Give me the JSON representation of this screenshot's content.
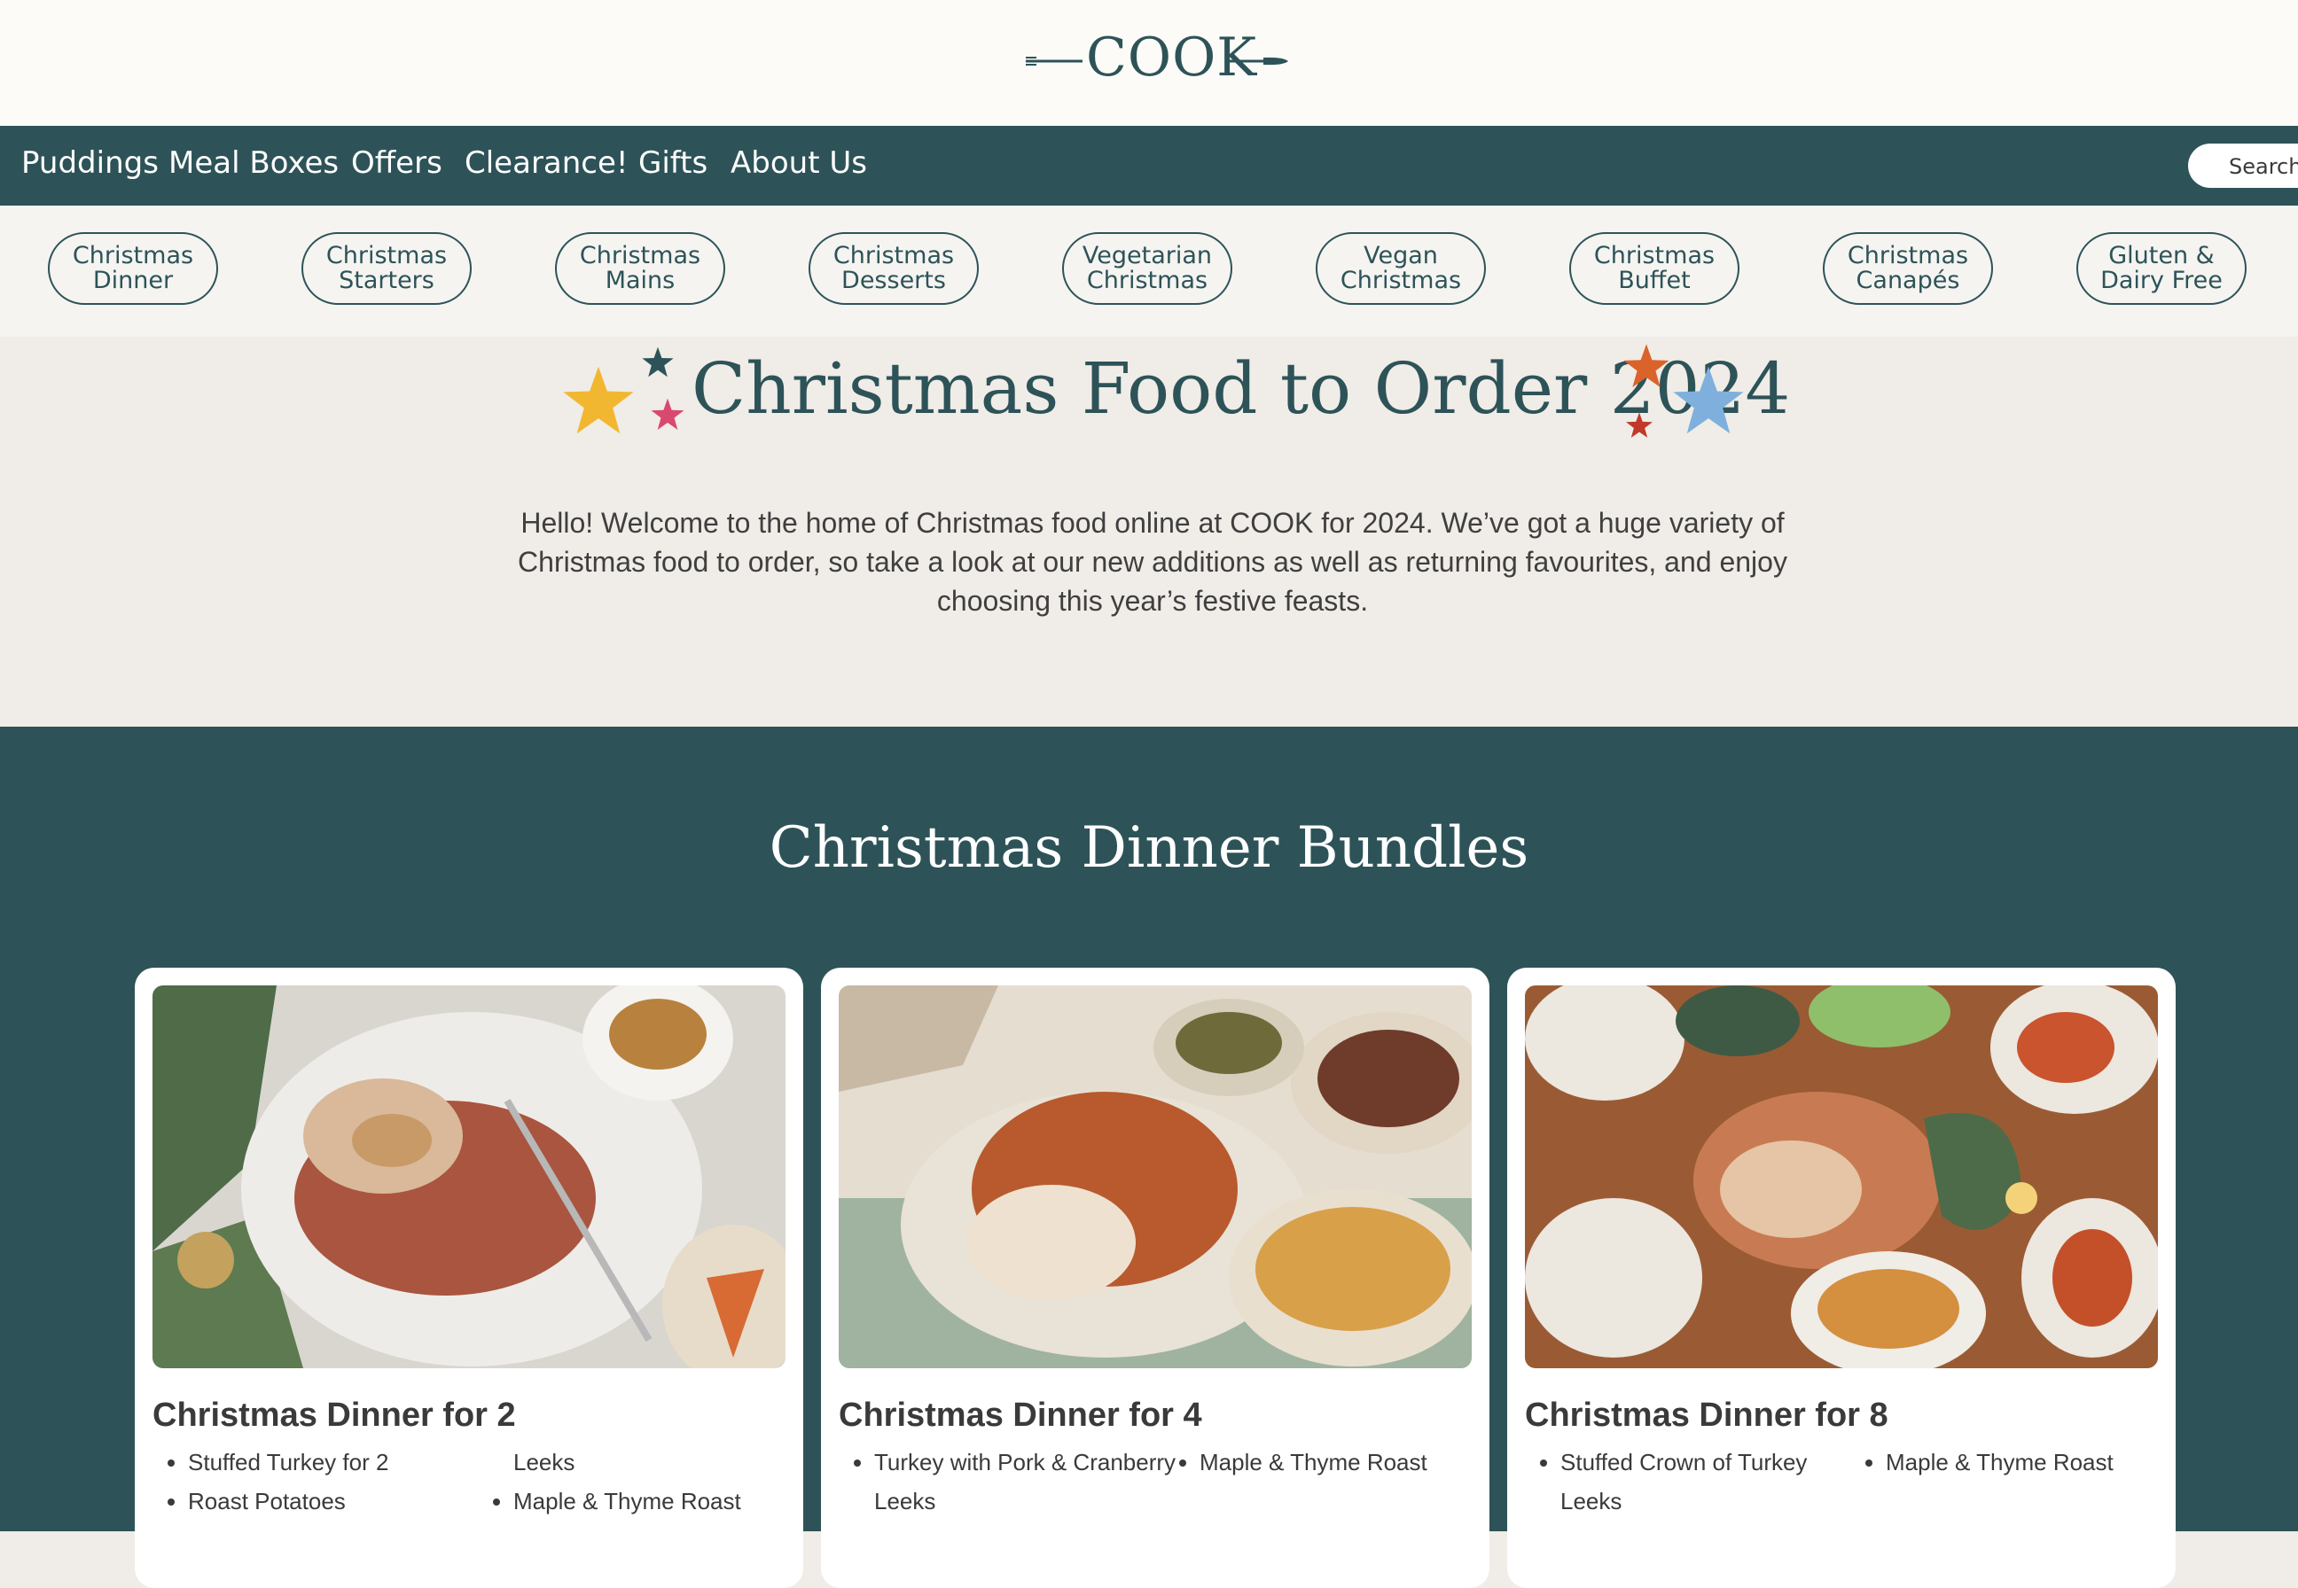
{
  "brand": {
    "logo_text": "COOK"
  },
  "nav": {
    "items": [
      "Puddings",
      "Meal Boxes",
      "Offers",
      "Clearance!",
      "Gifts",
      "About Us"
    ],
    "search_label": "Search"
  },
  "categories": [
    "Christmas\nDinner",
    "Christmas\nStarters",
    "Christmas\nMains",
    "Christmas\nDesserts",
    "Vegetarian\nChristmas",
    "Vegan\nChristmas",
    "Christmas\nBuffet",
    "Christmas\nCanapés",
    "Gluten &\nDairy Free"
  ],
  "hero": {
    "title": "Christmas Food to Order 2024",
    "text": "Hello! Welcome to the home of Christmas food online at COOK for 2024. We’ve got a huge variety of Christmas food to order, so take a look at our new additions as well as returning favourites, and enjoy choosing this year’s festive feasts."
  },
  "bundles": {
    "title": "Christmas Dinner Bundles",
    "cards": [
      {
        "title": "Christmas Dinner for 2",
        "items": [
          "Stuffed Turkey for 2",
          "Roast Potatoes",
          "Leeks",
          "Maple & Thyme Roast"
        ]
      },
      {
        "title": "Christmas Dinner for 4",
        "items": [
          "Turkey with Pork & Cranberry",
          "Leeks",
          "Maple & Thyme Roast"
        ]
      },
      {
        "title": "Christmas Dinner for 8",
        "items": [
          "Stuffed Crown of Turkey",
          "Leeks",
          "Maple & Thyme Roast"
        ]
      }
    ]
  },
  "colors": {
    "primary": "#2d5358",
    "page_bg": "#f0ece7",
    "header_bg": "#fcfbf7",
    "star_yellow": "#f2b731",
    "star_green": "#2d5358",
    "star_pink": "#d9496f",
    "star_orange": "#d9632b",
    "star_red": "#c0392b",
    "star_blue": "#7fb0dd"
  },
  "icons": [
    "fork-icon",
    "knife-icon",
    "star-icon"
  ]
}
